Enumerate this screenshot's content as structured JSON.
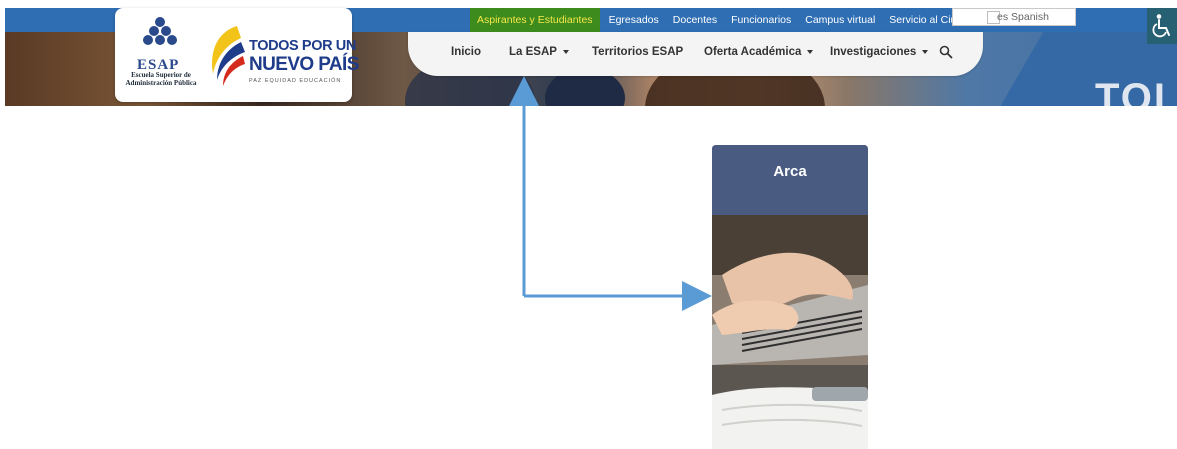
{
  "topbar": {
    "links": [
      {
        "label": "Aspirantes y Estudiantes",
        "active": true
      },
      {
        "label": "Egresados",
        "active": false
      },
      {
        "label": "Docentes",
        "active": false
      },
      {
        "label": "Funcionarios",
        "active": false
      },
      {
        "label": "Campus virtual",
        "active": false
      },
      {
        "label": "Servicio al Ciudadano",
        "active": false
      }
    ],
    "language": "es Spanish",
    "colors": {
      "bar": "#2f6eb3",
      "active_bg": "#3d8a1d",
      "active_text": "#f6e84a"
    }
  },
  "logos": {
    "esap_word": "ESAP",
    "esap_caption_line1": "Escuela Superior de",
    "esap_caption_line2": "Administración Pública",
    "slogan_line1": "TODOS POR UN",
    "slogan_line2": "NUEVO PAÍS",
    "slogan_line3": "PAZ EQUIDAD EDUCACIÓN"
  },
  "nav": {
    "items": [
      {
        "label": "Inicio",
        "dropdown": false
      },
      {
        "label": "La ESAP",
        "dropdown": true
      },
      {
        "label": "Territorios ESAP",
        "dropdown": false
      },
      {
        "label": "Oferta Académica",
        "dropdown": true
      },
      {
        "label": "Investigaciones",
        "dropdown": true
      }
    ],
    "search_icon": "search-icon"
  },
  "hero": {
    "partial_text": "TOI"
  },
  "card": {
    "title": "Arca",
    "image": "laptop-typing-photo"
  },
  "annotation": {
    "type": "arrow",
    "from": "Aspirantes y Estudiantes",
    "to": "Arca",
    "color": "#5b9bd5"
  },
  "icons": {
    "accessibility": "wheelchair-icon"
  }
}
